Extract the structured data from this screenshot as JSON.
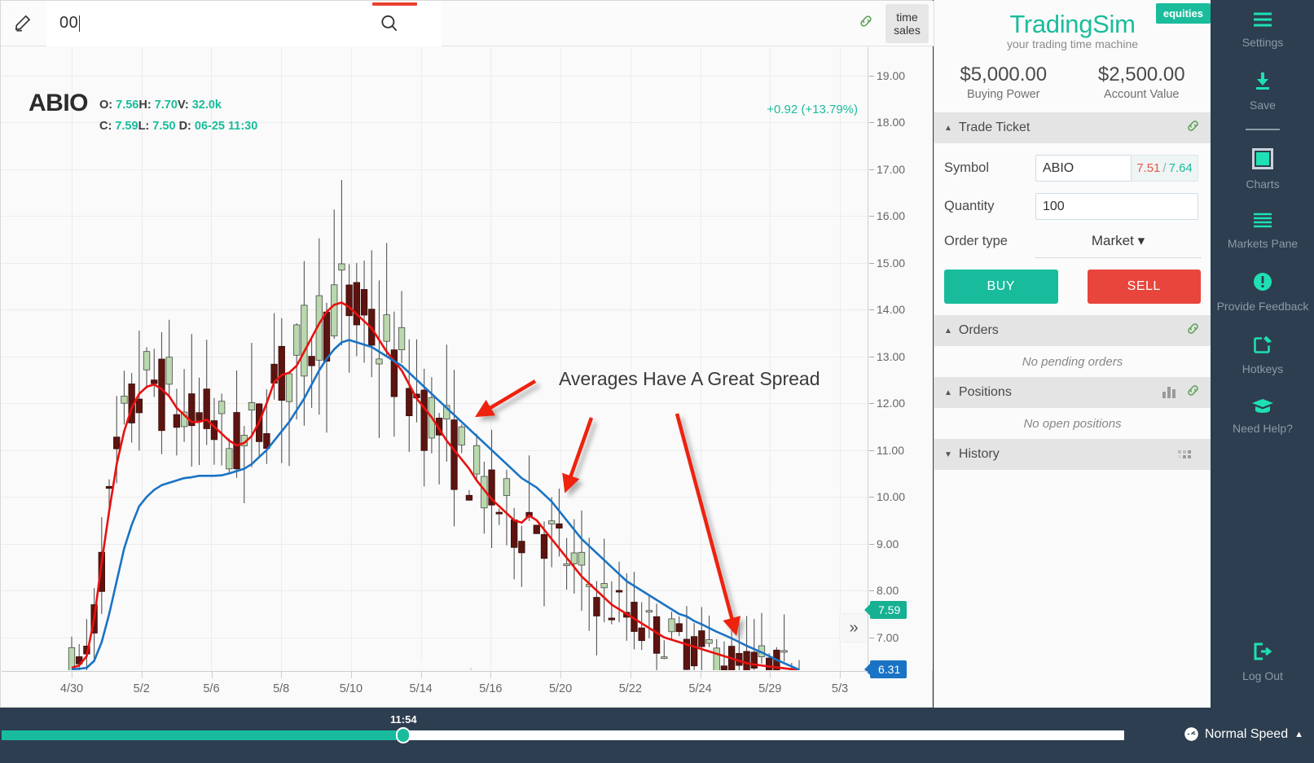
{
  "chart_toolbar": {
    "pencil_icon": "pencil-icon",
    "search_value": "00",
    "search_placeholder": "",
    "search_icon": "search-icon",
    "link_icon": "link-icon",
    "time_sales_line1": "time",
    "time_sales_line2": "sales"
  },
  "chart_header": {
    "symbol": "ABIO",
    "o_label": "O:",
    "o_value": "7.56",
    "h_label": "H:",
    "h_value": "7.70",
    "v_label": "V:",
    "v_value": "32.0k",
    "c_label": "C:",
    "c_value": "7.59",
    "l_label": "L:",
    "l_value": "7.50",
    "d_label": "D:",
    "d_value": "06-25 11:30",
    "change": "+0.92 (+13.79%)"
  },
  "chart_data": {
    "type": "line",
    "title": "ABIO",
    "xlabel": "",
    "ylabel": "",
    "ylim": [
      6.3,
      19.6
    ],
    "yticks": [
      19.0,
      18.0,
      17.0,
      16.0,
      15.0,
      14.0,
      13.0,
      12.0,
      11.0,
      10.0,
      9.0,
      8.0,
      7.0
    ],
    "ytick_labels": [
      "19.00",
      "18.00",
      "17.00",
      "16.00",
      "15.00",
      "14.00",
      "13.00",
      "12.00",
      "11.00",
      "10.00",
      "9.00",
      "8.00",
      "7.00"
    ],
    "xtick_labels": [
      "4/30",
      "5/2",
      "5/6",
      "5/8",
      "5/10",
      "5/14",
      "5/16",
      "5/20",
      "5/22",
      "5/24",
      "5/29",
      "5/3"
    ],
    "grid": true,
    "annotation": "Averages Have A Great Spread",
    "price_markers": [
      {
        "label": "7.59",
        "color": "#16b093",
        "name": "last-price-marker"
      },
      {
        "label": "6.31",
        "color": "#1a73c4",
        "name": "slow-ma-marker"
      }
    ],
    "series": [
      {
        "name": "fast-moving-average",
        "color": "#e8110f",
        "values": [
          6.35,
          6.4,
          6.6,
          7.4,
          8.6,
          9.7,
          10.7,
          11.4,
          11.9,
          12.2,
          12.35,
          12.4,
          12.3,
          12.15,
          11.9,
          11.75,
          11.6,
          11.6,
          11.65,
          11.5,
          11.35,
          11.2,
          11.1,
          11.15,
          11.3,
          11.6,
          12.0,
          12.45,
          12.6,
          12.65,
          12.8,
          13.1,
          13.4,
          13.7,
          13.95,
          14.1,
          14.15,
          14.05,
          13.9,
          13.75,
          13.6,
          13.35,
          13.1,
          12.9,
          12.7,
          12.4,
          12.1,
          11.9,
          11.7,
          11.45,
          11.2,
          11.0,
          10.8,
          10.6,
          10.35,
          10.15,
          9.95,
          9.8,
          9.65,
          9.5,
          9.45,
          9.6,
          9.5,
          9.3,
          9.1,
          8.9,
          8.7,
          8.5,
          8.3,
          8.15,
          8.0,
          7.85,
          7.7,
          7.6,
          7.5,
          7.4,
          7.3,
          7.2,
          7.1,
          7.0,
          6.95,
          6.9,
          6.85,
          6.8,
          6.75,
          6.7,
          6.65,
          6.6,
          6.55,
          6.5,
          6.45,
          6.42,
          6.4,
          6.38,
          6.36,
          6.34,
          6.32,
          6.31
        ]
      },
      {
        "name": "slow-moving-average",
        "color": "#1a73c4",
        "values": [
          6.32,
          6.33,
          6.35,
          6.5,
          6.9,
          7.5,
          8.2,
          8.9,
          9.4,
          9.8,
          10.0,
          10.15,
          10.25,
          10.3,
          10.35,
          10.4,
          10.42,
          10.45,
          10.45,
          10.45,
          10.46,
          10.5,
          10.55,
          10.6,
          10.7,
          10.85,
          11.0,
          11.2,
          11.4,
          11.6,
          11.85,
          12.1,
          12.4,
          12.7,
          12.95,
          13.15,
          13.3,
          13.35,
          13.3,
          13.25,
          13.2,
          13.1,
          13.0,
          12.9,
          12.8,
          12.65,
          12.5,
          12.35,
          12.2,
          12.05,
          11.9,
          11.75,
          11.6,
          11.45,
          11.3,
          11.15,
          11.0,
          10.85,
          10.7,
          10.55,
          10.4,
          10.3,
          10.2,
          10.05,
          9.9,
          9.7,
          9.5,
          9.3,
          9.1,
          8.95,
          8.8,
          8.65,
          8.5,
          8.35,
          8.2,
          8.1,
          8.0,
          7.9,
          7.8,
          7.7,
          7.6,
          7.5,
          7.45,
          7.35,
          7.28,
          7.2,
          7.12,
          7.05,
          6.98,
          6.9,
          6.82,
          6.75,
          6.68,
          6.6,
          6.52,
          6.45,
          6.38,
          6.31
        ]
      }
    ],
    "candles_note": "OHLC candlestick series, green up / dark-red down",
    "zoom_controls": {
      "out": "−",
      "in": "+"
    },
    "forward_button": "»"
  },
  "side_panel": {
    "brand_name": "TradingSim",
    "brand_tagline": "your trading time machine",
    "equities_badge": "equities",
    "buying_power_value": "$5,000.00",
    "buying_power_label": "Buying Power",
    "account_value_value": "$2,500.00",
    "account_value_label": "Account Value",
    "trade_ticket": {
      "title": "Trade Ticket",
      "link_icon": "link-icon",
      "symbol_label": "Symbol",
      "symbol_value": "ABIO",
      "bid": "7.51",
      "separator": "/",
      "ask": "7.64",
      "quantity_label": "Quantity",
      "quantity_value": "100",
      "order_type_label": "Order type",
      "order_type_value": "Market",
      "buy_label": "BUY",
      "sell_label": "SELL"
    },
    "orders": {
      "title": "Orders",
      "empty": "No pending orders",
      "link_icon": "link-icon"
    },
    "positions": {
      "title": "Positions",
      "empty": "No open positions",
      "chart_icon": "bar-chart-icon",
      "link_icon": "link-icon"
    },
    "history": {
      "title": "History",
      "grid_icon": "grid-icon"
    }
  },
  "rail": {
    "items": [
      {
        "label": "Settings",
        "icon": "hamburger-icon"
      },
      {
        "label": "Save",
        "icon": "download-icon"
      },
      {
        "label": "Charts",
        "icon": "square-icon"
      },
      {
        "label": "Markets Pane",
        "icon": "list-icon"
      },
      {
        "label": "Provide Feedback",
        "icon": "exclamation-circle-icon"
      },
      {
        "label": "Hotkeys",
        "icon": "edit-square-icon"
      },
      {
        "label": "Need Help?",
        "icon": "graduation-cap-icon"
      }
    ],
    "logout": {
      "label": "Log Out",
      "icon": "logout-icon"
    }
  },
  "bottom_bar": {
    "current_time": "11:54",
    "progress_percent": 35.8,
    "speed_label": "Normal Speed",
    "speed_icon": "speedometer-icon",
    "speed_caret": "▲"
  },
  "colors": {
    "accent_teal": "#1abc9c",
    "sell_red": "#e8453c",
    "fast_ma": "#e8110f",
    "slow_ma": "#1a73c4",
    "rail_bg": "#2d3e50"
  }
}
